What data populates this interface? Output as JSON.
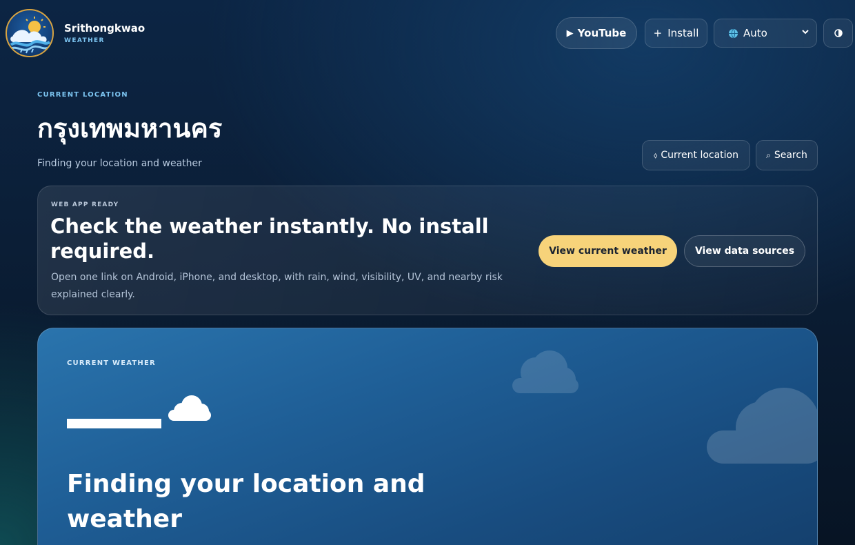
{
  "header": {
    "brand_name": "Srithongkwao",
    "brand_sub": "WEATHER",
    "youtube_label": "YouTube",
    "install_label": "Install",
    "language_value": "Auto"
  },
  "location": {
    "eyebrow": "CURRENT LOCATION",
    "name": "กรุงเทพมหานคร",
    "status": "Finding your location and weather",
    "current_location_label": "Current location",
    "search_label": "Search"
  },
  "promo": {
    "eyebrow": "WEB APP READY",
    "title": "Check the weather instantly. No install required.",
    "description": "Open one link on Android, iPhone, and desktop, with rain, wind, visibility, UV, and nearby risk explained clearly.",
    "primary_label": "View current weather",
    "secondary_label": "View data sources"
  },
  "current_weather": {
    "eyebrow": "CURRENT WEATHER",
    "headline": "Finding your location and weather"
  },
  "icons": {
    "logo": "weather-logo-icon",
    "youtube": "play-icon",
    "install": "plus-icon",
    "language": "globe-icon",
    "theme": "contrast-icon",
    "current_location": "location-arrow-icon",
    "search": "search-icon",
    "weather": "cloud-icon"
  },
  "colors": {
    "accent": "#7cc4f0",
    "primary_button": "#f7d37a",
    "weather_card": "#1f5f97",
    "background": "#0b1e36"
  }
}
